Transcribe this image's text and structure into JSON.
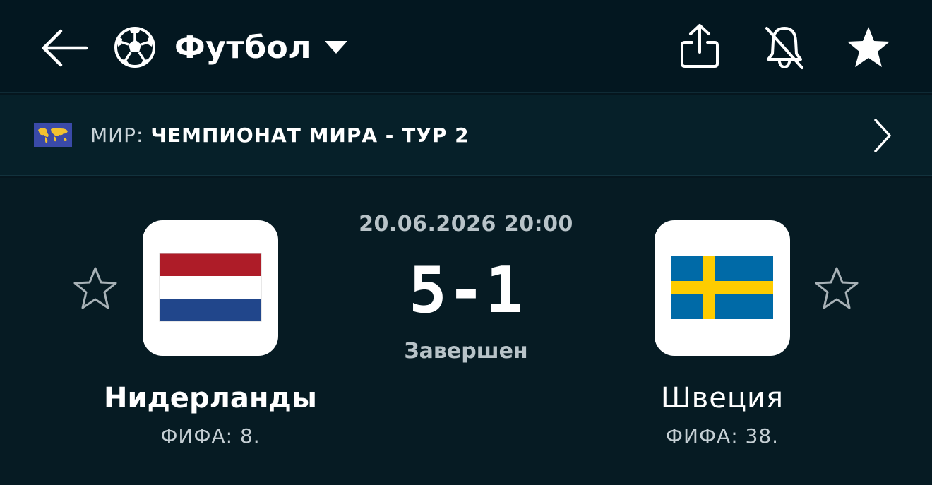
{
  "header": {
    "sport_title": "Футбол",
    "icons": {
      "back": "arrow-left-icon",
      "sport": "soccer-ball-icon",
      "dropdown": "caret-down-icon",
      "share": "share-icon",
      "notifications": "bell-off-icon",
      "favorite": "star-filled-icon"
    }
  },
  "league": {
    "country": "МИР:",
    "name": "ЧЕМПИОНАТ МИРА - ТУР 2",
    "flag_icon": "world-map-flag-icon",
    "chevron_icon": "chevron-right-icon"
  },
  "match": {
    "datetime": "20.06.2026 20:00",
    "score": "5-1",
    "status": "Завершен",
    "home": {
      "name": "Нидерланды",
      "rank": "ФИФА: 8.",
      "flag_colors": [
        "#ae1c28",
        "#ffffff",
        "#21468b"
      ]
    },
    "away": {
      "name": "Швеция",
      "rank": "ФИФА: 38.",
      "flag_colors": [
        "#006aa7",
        "#fecc00"
      ]
    }
  },
  "colors": {
    "background": "#05161e",
    "header_bg": "#031720",
    "league_bg": "#062029",
    "text_primary": "#ffffff",
    "text_secondary": "#b8c3c8"
  }
}
